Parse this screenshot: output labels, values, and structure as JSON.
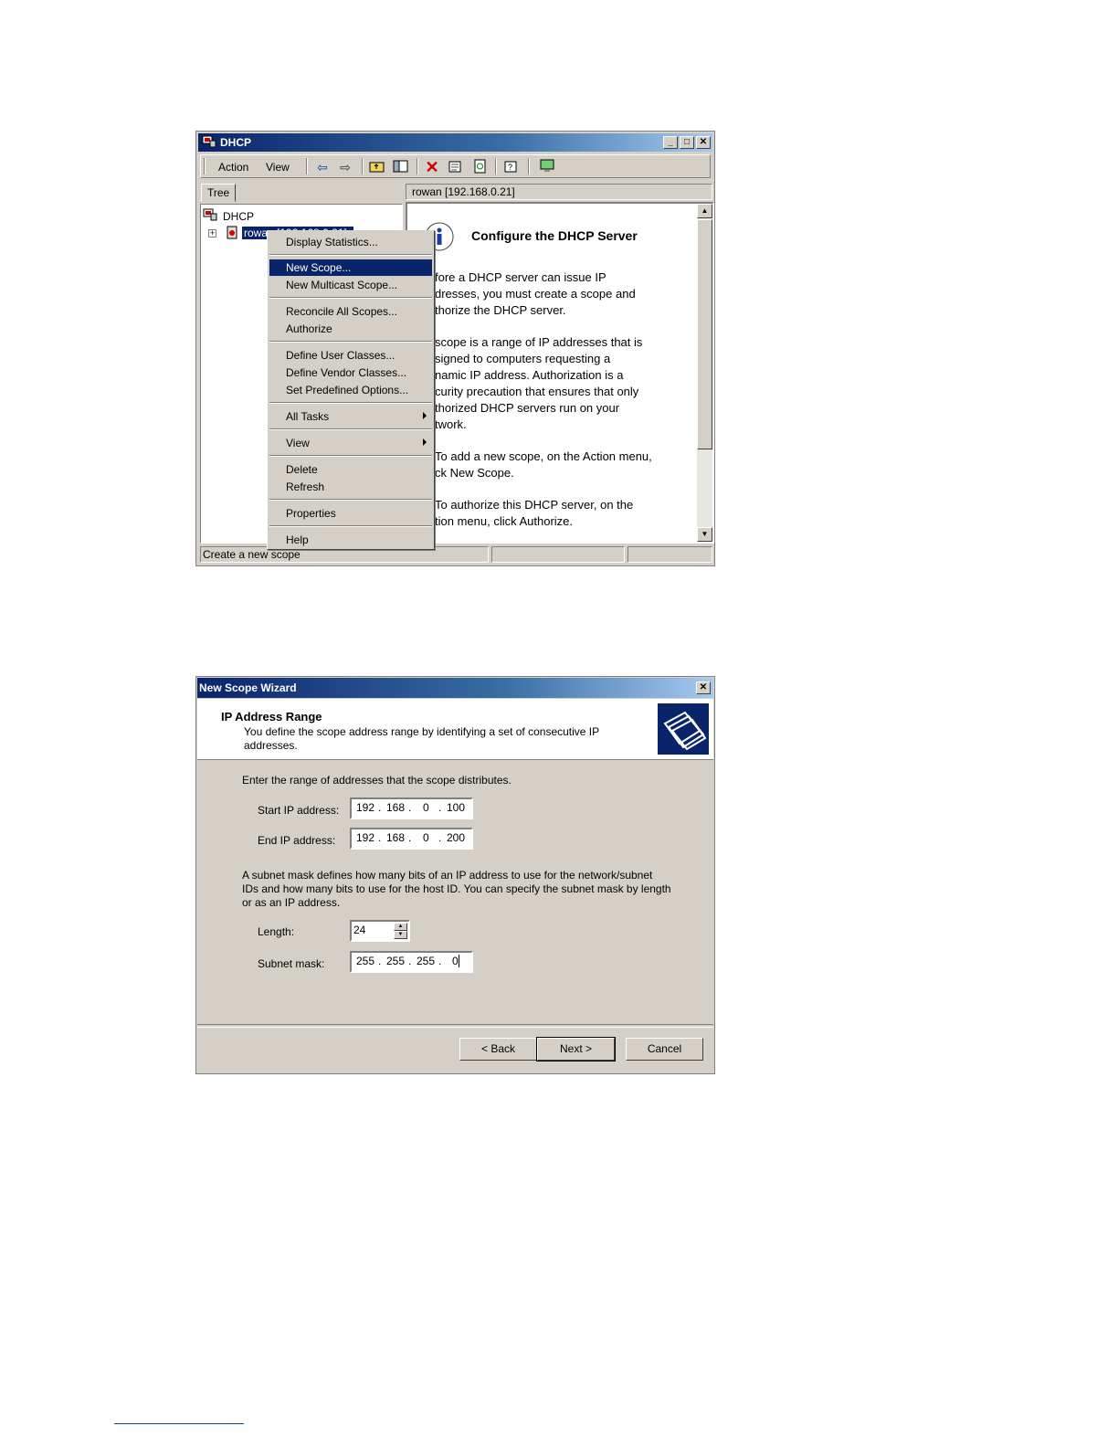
{
  "dhcp_window": {
    "title": "DHCP",
    "menu": [
      "Action",
      "View"
    ],
    "tree_tab": "Tree",
    "tree": {
      "root": "DHCP",
      "server_node": "rowan [192.168.0.21]"
    },
    "right_header": "rowan [192.168.0.21]",
    "info_title": "Configure the DHCP Server",
    "info_paragraphs": [
      "fore a DHCP server can issue IP\ndresses, you must create a scope and\nthorize the DHCP server.",
      "scope is a range of IP addresses that is\nsigned to computers requesting a\nnamic IP address. Authorization is a\ncurity precaution that ensures that only\nthorized DHCP servers run on your\ntwork.",
      "To add a new scope, on the Action menu,\nck New Scope.",
      "To authorize this DHCP server, on the\ntion menu, click Authorize."
    ],
    "status_text": "Create a new scope",
    "context_menu": {
      "items": [
        "Display Statistics...",
        "New Scope...",
        "New Multicast Scope...",
        "Reconcile All Scopes...",
        "Authorize",
        "Define User Classes...",
        "Define Vendor Classes...",
        "Set Predefined Options...",
        "All Tasks",
        "View",
        "Delete",
        "Refresh",
        "Properties",
        "Help"
      ],
      "selected": "New Scope..."
    }
  },
  "wizard": {
    "title": "New Scope Wizard",
    "heading": "IP Address Range",
    "subheading": "You define the scope address range by identifying a set of consecutive IP addresses.",
    "intro": "Enter the range of addresses that the scope distributes.",
    "start_label": "Start IP address:",
    "start_ip": [
      "192",
      "168",
      "0",
      "100"
    ],
    "end_label": "End IP address:",
    "end_ip": [
      "192",
      "168",
      "0",
      "200"
    ],
    "mask_desc": "A subnet mask defines how many bits of an IP address to use for the network/subnet IDs and how many bits to use for the host ID. You can specify the subnet mask by length or as an IP address.",
    "length_label": "Length:",
    "length_value": "24",
    "mask_label": "Subnet mask:",
    "subnet_mask": [
      "255",
      "255",
      "255",
      "0"
    ],
    "buttons": {
      "back": "< Back",
      "next": "Next >",
      "cancel": "Cancel"
    }
  }
}
